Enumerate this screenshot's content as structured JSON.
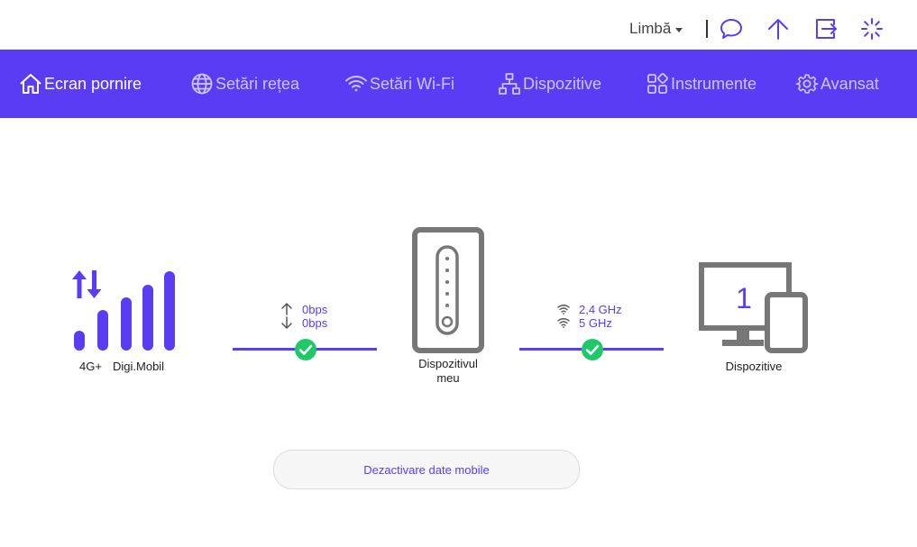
{
  "topbar": {
    "language_label": "Limbă",
    "icons": [
      "chat-icon",
      "upload-arrow-icon",
      "logout-icon",
      "loading-spinner-icon"
    ]
  },
  "nav": {
    "items": [
      {
        "label": "Ecran pornire",
        "icon": "home-icon",
        "active": true
      },
      {
        "label": "Setări rețea",
        "icon": "globe-icon",
        "active": false
      },
      {
        "label": "Setări Wi-Fi",
        "icon": "wifi-icon",
        "active": false
      },
      {
        "label": "Dispozitive",
        "icon": "network-devices-icon",
        "active": false
      },
      {
        "label": "Instrumente",
        "icon": "tools-grid-icon",
        "active": false
      },
      {
        "label": "Avansat",
        "icon": "gear-icon",
        "active": false
      }
    ]
  },
  "status": {
    "network_type": "4G+",
    "operator": "Digi.Mobil",
    "upload_speed": "0bps",
    "download_speed": "0bps",
    "router_label": "Dispozitivul meu",
    "wifi_band_1": "2,4 GHz",
    "wifi_band_2": "5 GHz",
    "devices_count": "1",
    "devices_label": "Dispozitive"
  },
  "actions": {
    "mobile_data_button": "Dezactivare date mobile"
  },
  "colors": {
    "accent": "#5a3cf5",
    "nav_inactive_text": "#cfc6ff",
    "success": "#1fc96a",
    "device_gray": "#757575"
  }
}
